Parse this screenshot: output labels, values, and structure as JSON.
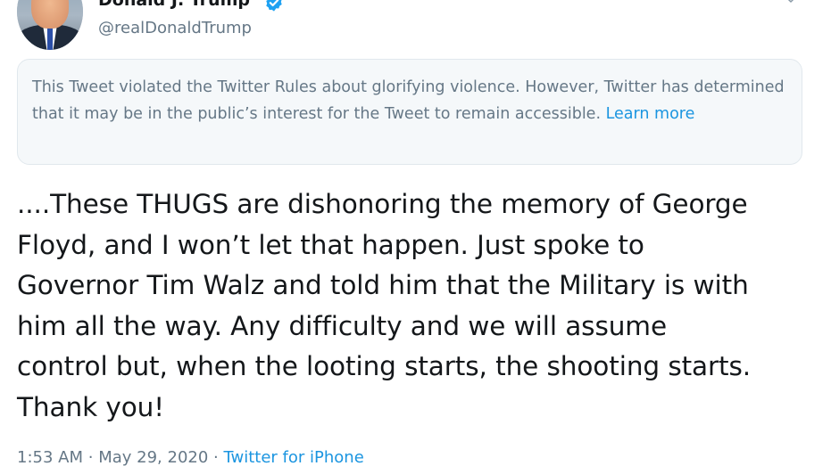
{
  "author": {
    "display_name": "Donald J. Trump",
    "handle": "@realDonaldTrump",
    "verified": true
  },
  "notice": {
    "text": "This Tweet violated the Twitter Rules about glorifying violence. However, Twitter has determined that it may be in the public’s interest for the Tweet to remain accessible.",
    "link_label": "Learn more"
  },
  "tweet": {
    "lines": [
      "....These THUGS are dishonoring the memory of George",
      "Floyd, and I won’t let that happen. Just spoke to",
      "Governor Tim Walz and told him that the Military is with",
      "him all the way. Any difficulty and we will assume",
      "control but, when the looting starts, the shooting starts.",
      "Thank you!"
    ]
  },
  "meta": {
    "time": "1:53 AM",
    "separator": "·",
    "date": "May 29, 2020",
    "source": "Twitter for iPhone"
  },
  "colors": {
    "accent": "#1b95e0",
    "text_primary": "#14171a",
    "text_secondary": "#657786",
    "notice_bg": "#f5f8fa",
    "notice_border": "#e1e8ed"
  },
  "icons": {
    "verified": "verified-badge-icon",
    "chevron": "chevron-down-icon"
  }
}
